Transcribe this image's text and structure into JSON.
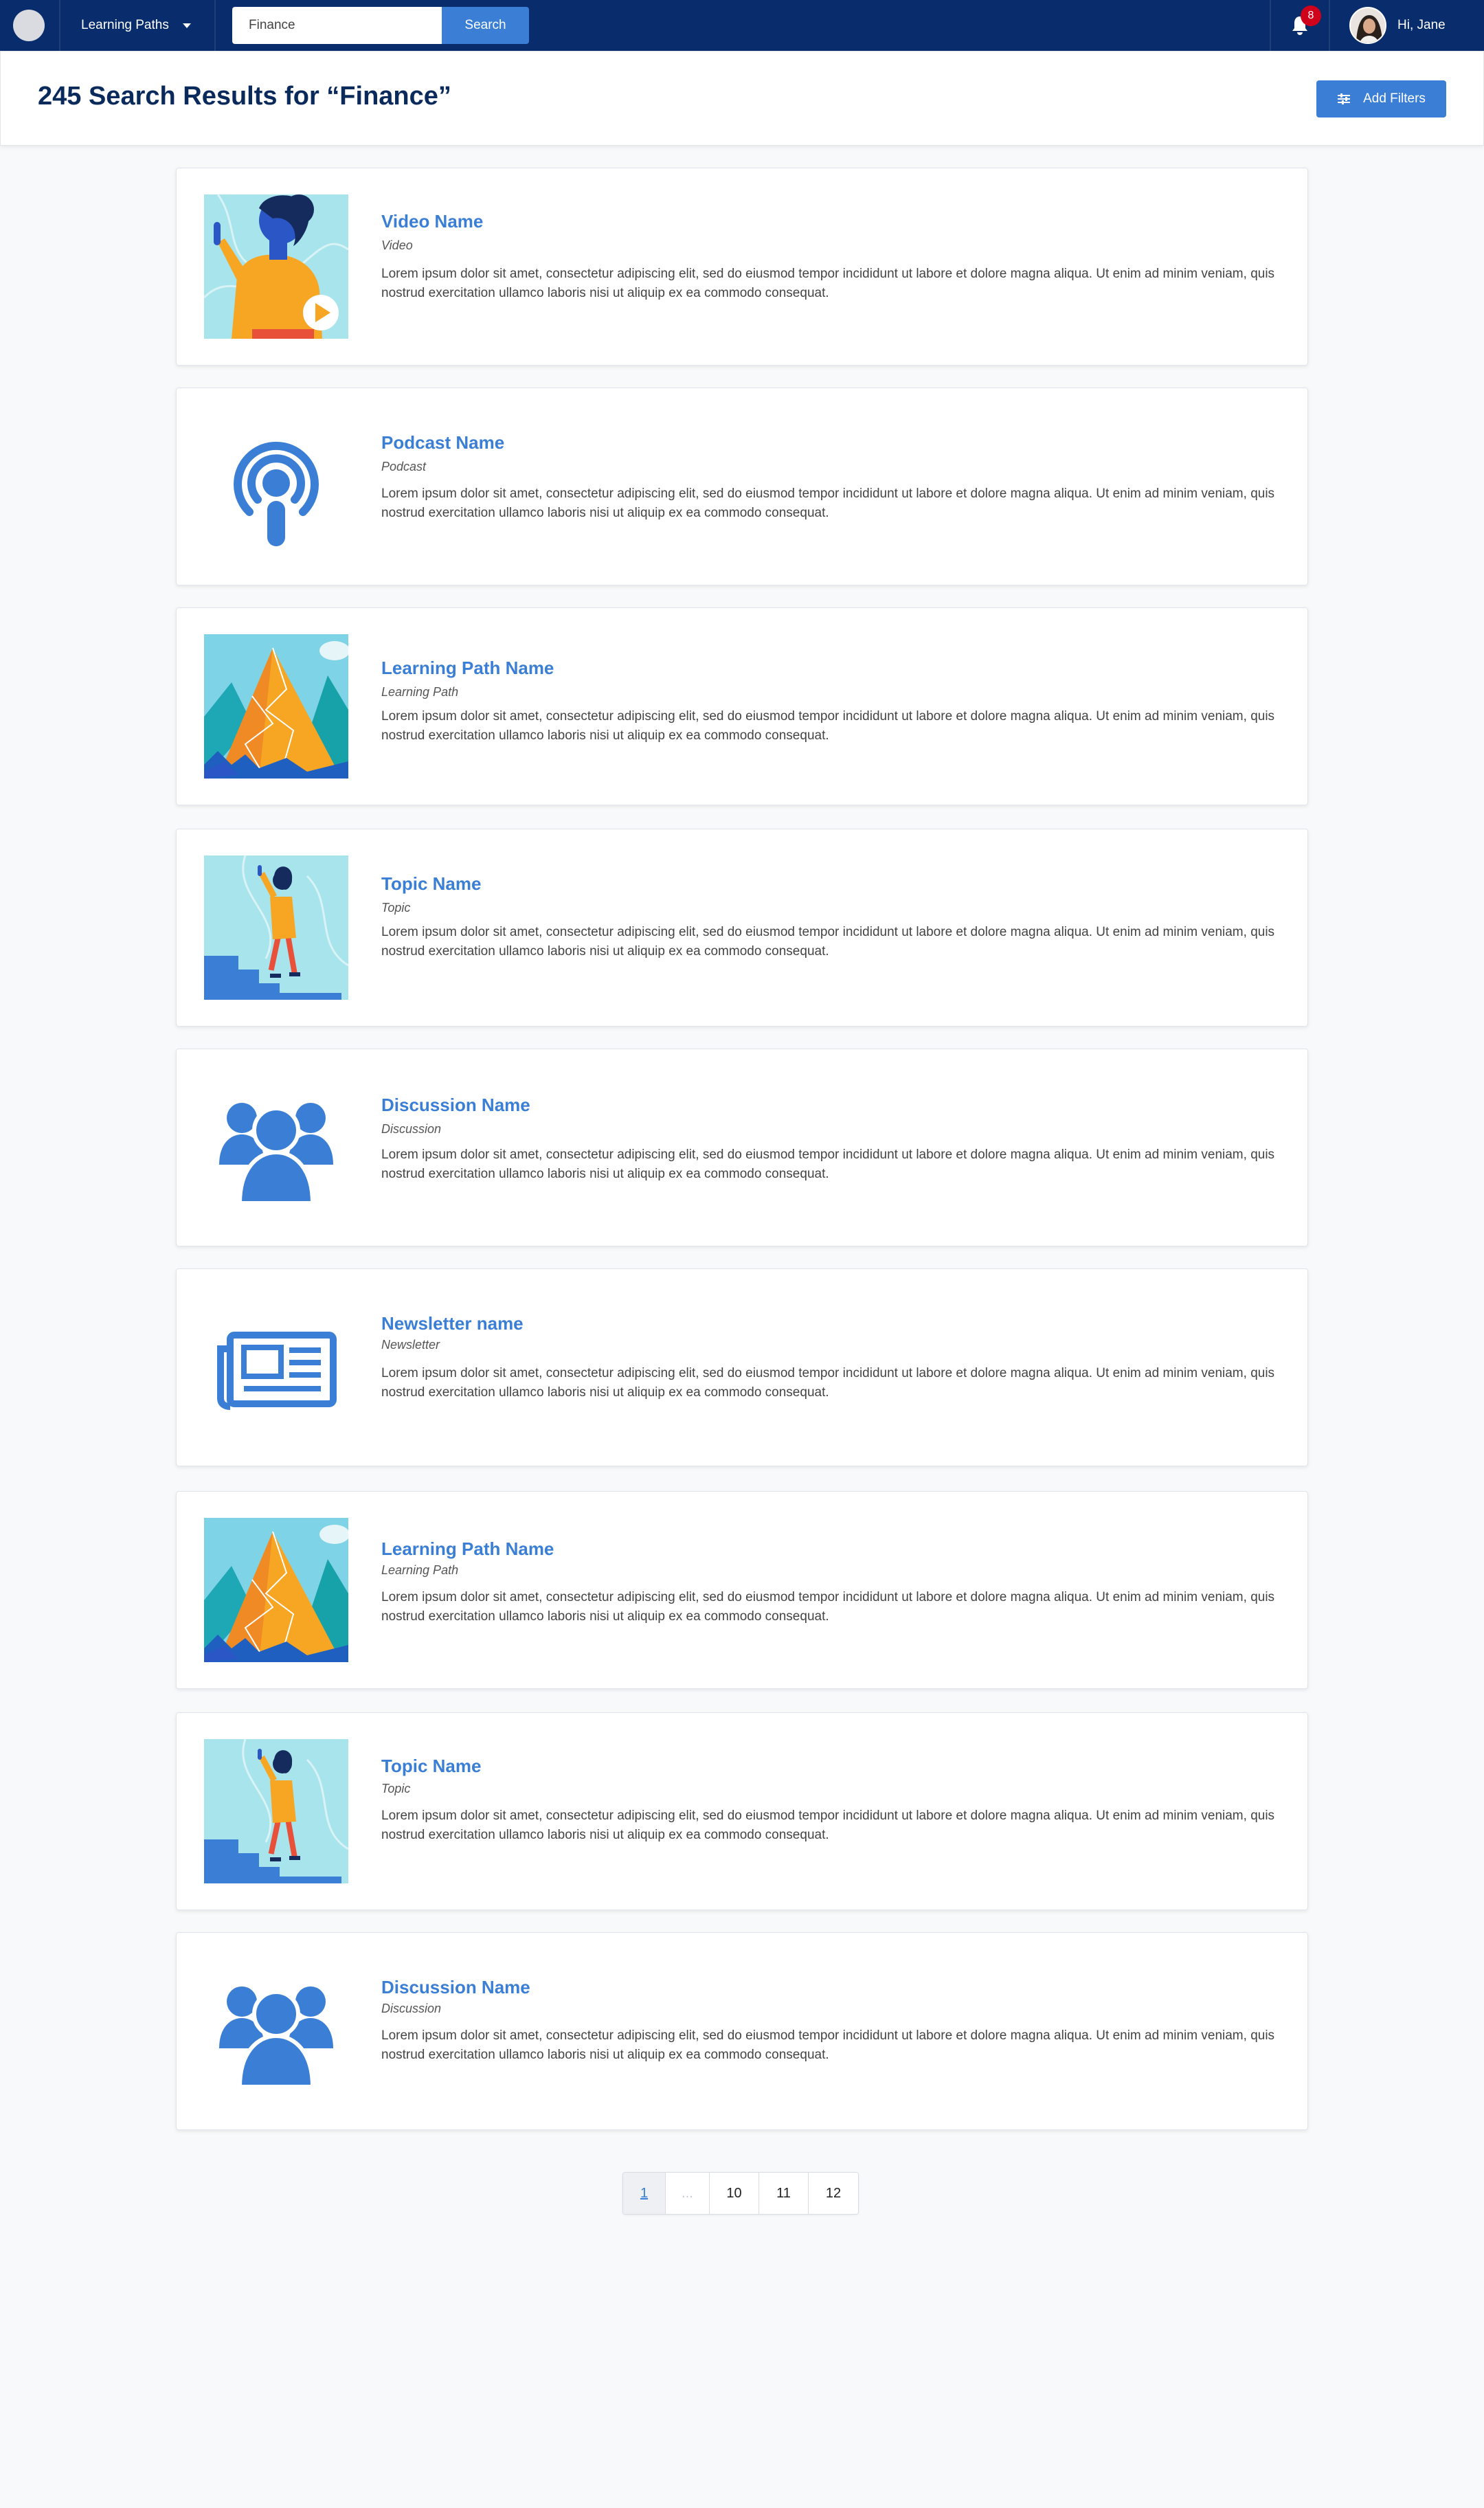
{
  "nav": {
    "menu_label": "Learning Paths",
    "search_value": "Finance",
    "search_button": "Search",
    "notification_count": "8",
    "greeting": "Hi, Jane"
  },
  "header": {
    "title": "245 Search Results for “Finance”",
    "filter_button": "Add Filters"
  },
  "results": [
    {
      "title": "Video Name",
      "type": "Video",
      "icon": "video-thumbnail",
      "description": "Lorem ipsum dolor sit amet, consectetur adipiscing elit, sed do eiusmod tempor incididunt ut labore et dolore magna aliqua. Ut enim ad minim veniam, quis nostrud exercitation ullamco laboris nisi ut aliquip ex ea commodo consequat."
    },
    {
      "title": "Podcast Name",
      "type": "Podcast",
      "icon": "podcast-icon",
      "description": "Lorem ipsum dolor sit amet, consectetur adipiscing elit, sed do eiusmod tempor incididunt ut labore et dolore magna aliqua. Ut enim ad minim veniam, quis nostrud exercitation ullamco laboris nisi ut aliquip ex ea commodo consequat."
    },
    {
      "title": "Learning Path Name",
      "type": "Learning Path",
      "icon": "mountain-thumbnail",
      "description": "Lorem ipsum dolor sit amet, consectetur adipiscing elit, sed do eiusmod tempor incididunt ut labore et dolore magna aliqua. Ut enim ad minim veniam, quis nostrud exercitation ullamco laboris nisi ut aliquip ex ea commodo consequat."
    },
    {
      "title": "Topic Name",
      "type": "Topic",
      "icon": "stairs-thumbnail",
      "description": "Lorem ipsum dolor sit amet, consectetur adipiscing elit, sed do eiusmod tempor incididunt ut labore et dolore magna aliqua. Ut enim ad minim veniam, quis nostrud exercitation ullamco laboris nisi ut aliquip ex ea commodo consequat."
    },
    {
      "title": "Discussion Name",
      "type": "Discussion",
      "icon": "group-icon",
      "description": "Lorem ipsum dolor sit amet, consectetur adipiscing elit, sed do eiusmod tempor incididunt ut labore et dolore magna aliqua. Ut enim ad minim veniam, quis nostrud exercitation ullamco laboris nisi ut aliquip ex ea commodo consequat."
    },
    {
      "title": "Newsletter name",
      "type": "Newsletter",
      "icon": "newspaper-icon",
      "description": "Lorem ipsum dolor sit amet, consectetur adipiscing elit, sed do eiusmod tempor incididunt ut labore et dolore magna aliqua. Ut enim ad minim veniam, quis nostrud exercitation ullamco laboris nisi ut aliquip ex ea commodo consequat."
    },
    {
      "title": "Learning Path Name",
      "type": "Learning Path",
      "icon": "mountain-thumbnail",
      "description": "Lorem ipsum dolor sit amet, consectetur adipiscing elit, sed do eiusmod tempor incididunt ut labore et dolore magna aliqua. Ut enim ad minim veniam, quis nostrud exercitation ullamco laboris nisi ut aliquip ex ea commodo consequat."
    },
    {
      "title": "Topic Name",
      "type": "Topic",
      "icon": "stairs-thumbnail",
      "description": "Lorem ipsum dolor sit amet, consectetur adipiscing elit, sed do eiusmod tempor incididunt ut labore et dolore magna aliqua. Ut enim ad minim veniam, quis nostrud exercitation ullamco laboris nisi ut aliquip ex ea commodo consequat."
    },
    {
      "title": "Discussion Name",
      "type": "Discussion",
      "icon": "group-icon",
      "description": "Lorem ipsum dolor sit amet, consectetur adipiscing elit, sed do eiusmod tempor incididunt ut labore et dolore magna aliqua. Ut enim ad minim veniam, quis nostrud exercitation ullamco laboris nisi ut aliquip ex ea commodo consequat."
    }
  ],
  "pagination": {
    "pages": [
      "1",
      "...",
      "10",
      "11",
      "12"
    ],
    "current": "1"
  },
  "colors": {
    "nav_bg": "#082c6c",
    "accent": "#3a7fd5",
    "title": "#0b2a5c",
    "badge": "#d0021b"
  }
}
